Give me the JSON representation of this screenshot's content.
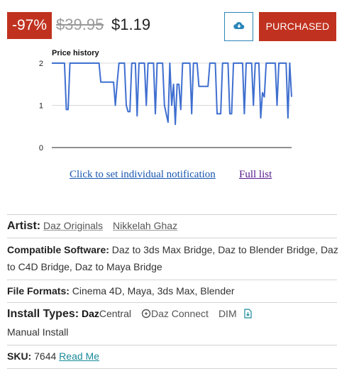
{
  "price": {
    "discount": "-97%",
    "old_price": "$39.95",
    "new_price": "$1.19",
    "purchased_label": "PURCHASED",
    "download_icon": "cloud-download-icon",
    "accent_color": "#c0321f",
    "download_border_color": "#2a86b8"
  },
  "chart_data": {
    "type": "line",
    "title": "Price history",
    "xlabel": "",
    "ylabel": "",
    "ylim": [
      0,
      2
    ],
    "yticks": [
      0,
      1,
      2
    ],
    "grid": true,
    "line_color": "#3f6fd0",
    "series": [
      {
        "values": [
          2,
          2,
          2,
          2,
          2,
          2,
          2,
          2,
          0.9,
          0.9,
          2,
          2,
          2,
          2,
          2,
          2,
          2,
          2,
          2,
          2,
          2,
          2,
          2,
          2,
          2,
          2,
          2,
          1.55,
          1.55,
          1.55,
          1.55,
          1.55,
          1.55,
          1.55,
          1.55,
          1.0,
          1.55,
          2,
          2,
          2,
          2,
          1.0,
          0.85,
          0.85,
          2,
          2,
          2,
          0.75,
          2,
          2,
          2,
          2,
          1.0,
          2,
          2,
          2,
          2,
          0.8,
          2,
          2,
          2,
          2,
          1.0,
          0.8,
          0.6,
          2,
          1.0,
          1.5,
          0.55,
          1.5,
          1.5,
          0.9,
          2,
          2,
          2,
          2,
          2,
          0.8,
          2,
          2,
          2,
          1.45,
          1.45,
          1.45,
          1.45,
          1.45,
          1.45,
          2,
          2,
          2,
          2,
          0.8,
          0.8,
          0.8,
          2,
          2,
          2,
          2,
          0.8,
          0.8,
          2,
          2,
          2,
          2,
          2,
          2,
          0.8,
          2,
          2,
          2,
          2,
          1.0,
          2,
          2,
          2,
          0.7,
          1.3,
          1.2,
          2,
          2,
          2,
          2,
          2,
          2,
          1.0,
          2,
          2,
          2,
          2,
          2,
          0.7,
          2,
          1.2
        ]
      }
    ]
  },
  "links": {
    "notify": "Click to set individual notification",
    "full_list": "Full list"
  },
  "details": {
    "artist_label": "Artist:",
    "artists": [
      "Daz Originals",
      "Nikkelah Ghaz"
    ],
    "software_label": "Compatible Software:",
    "software_value": "Daz to 3ds Max Bridge, Daz to Blender Bridge, Daz to C4D Bridge, Daz to Maya Bridge",
    "formats_label": "File Formats:",
    "formats_value": "Cinema 4D, Maya, 3ds Max, Blender",
    "install_label": "Install Types:",
    "install_daz_bold": "Daz",
    "install_daz_rest": "Central",
    "install_connect": "Daz Connect",
    "install_dim": "DIM",
    "install_manual": "Manual Install",
    "sku_label": "SKU:",
    "sku_value": "7644",
    "readme_label": "Read Me"
  }
}
